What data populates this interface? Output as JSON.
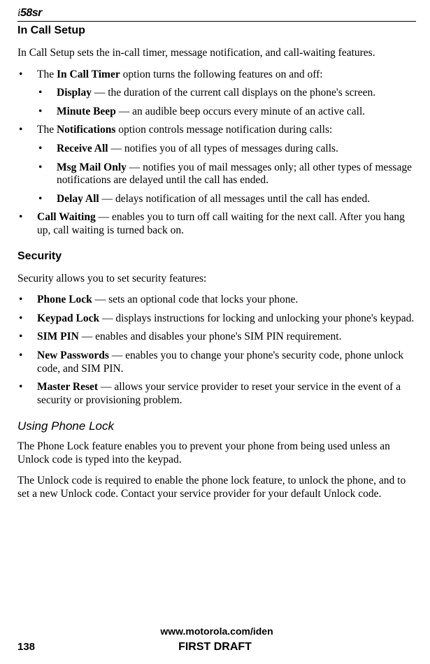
{
  "header": {
    "logo": "58sr"
  },
  "sections": {
    "incall": {
      "heading": "In Call Setup",
      "intro": "In Call Setup sets the in-call timer, message notification, and call-waiting features.",
      "item1_prefix": "The ",
      "item1_bold": "In Call Timer",
      "item1_suffix": " option turns the following features on and off:",
      "item1a_bold": "Display",
      "item1a_text": " — the duration of the current call displays on the phone's screen.",
      "item1b_bold": "Minute Beep",
      "item1b_text": " — an audible beep occurs every minute of an active call.",
      "item2_prefix": "The ",
      "item2_bold": "Notifications",
      "item2_suffix": " option controls message notification during calls:",
      "item2a_bold": "Receive All",
      "item2a_text": " — notifies you of all types of messages during calls.",
      "item2b_bold": "Msg Mail Only",
      "item2b_text": " — notifies you of mail messages only; all other types of message notifications are delayed until the call has ended.",
      "item2c_bold": "Delay All",
      "item2c_text": " — delays notification of all messages until the call has ended.",
      "item3_bold": "Call Waiting",
      "item3_text": " — enables you to turn off call waiting for the next call. After you hang up, call waiting is turned back on."
    },
    "security": {
      "heading": "Security",
      "intro": "Security allows you to set security features:",
      "item1_bold": "Phone Lock",
      "item1_text": " — sets an optional code that locks your phone.",
      "item2_bold": "Keypad Lock",
      "item2_text": " — displays instructions for locking and unlocking your phone's keypad.",
      "item3_bold": "SIM PIN",
      "item3_text": " — enables and disables your phone's SIM PIN requirement.",
      "item4_bold": "New Passwords",
      "item4_text": " — enables you to change your phone's security code, phone unlock code, and SIM PIN.",
      "item5_bold": "Master Reset",
      "item5_text": " — allows your service provider to reset your service in the event of a security or provisioning problem."
    },
    "phonelock": {
      "heading": "Using Phone Lock",
      "para1": "The Phone Lock feature enables you to prevent your phone from being used unless an Unlock code is typed into the keypad.",
      "para2": "The Unlock code is required to enable the phone lock feature, to unlock the phone, and to set a new Unlock code. Contact your service provider for your default Unlock code."
    }
  },
  "footer": {
    "url": "www.motorola.com/iden",
    "page": "138",
    "draft": "FIRST DRAFT"
  }
}
